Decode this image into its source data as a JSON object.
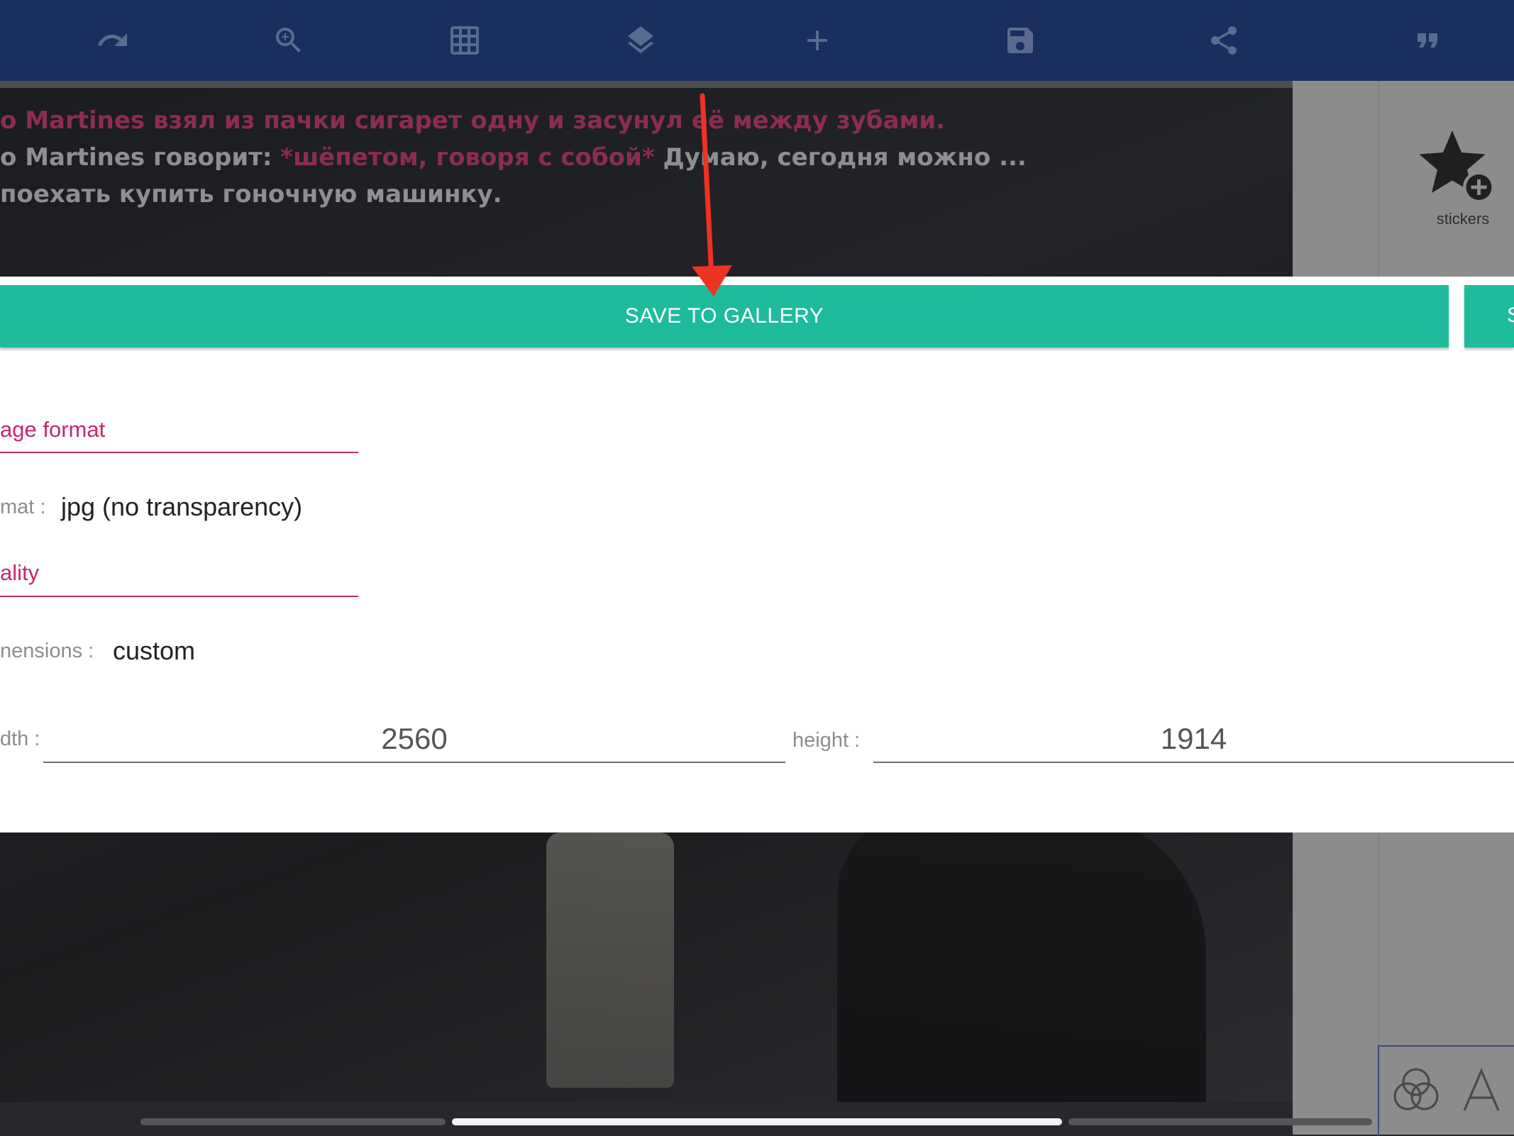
{
  "toolbar": {
    "icons": [
      "undo-icon",
      "zoom-in-icon",
      "grid-icon",
      "layers-icon",
      "add-icon",
      "save-icon",
      "share-icon",
      "quote-icon"
    ]
  },
  "canvas": {
    "chat_lines": [
      {
        "text": "o Martines взял из пачки сигарет одну и засунул её между зубами."
      },
      {
        "prefix": "o Martines говорит: ",
        "pink": "*шёпетом, говоря с собой*",
        "suffix": " Думаю, сегодня можно ..."
      },
      {
        "text": "поехать купить гоночную машинку."
      }
    ]
  },
  "sidebar": {
    "stickers_label": "stickers",
    "bottom_icons": [
      "color-blend-icon",
      "text-icon"
    ]
  },
  "dialog": {
    "save_to_gallery": "SAVE TO GALLERY",
    "second_button_partial": "S",
    "image_format_title": "age format",
    "format_label": "mat :",
    "format_value": "jpg (no transparency)",
    "quality_title": "ality",
    "dimensions_label": "nensions :",
    "dimensions_value": "custom",
    "width_label": "dth :",
    "width_value": "2560",
    "height_label": "height :",
    "height_value": "1914"
  },
  "colors": {
    "toolbar": "#1a2f5e",
    "accent_button": "#1fbc9c",
    "section_title": "#c4286e",
    "annotation_arrow": "#ee3322"
  }
}
